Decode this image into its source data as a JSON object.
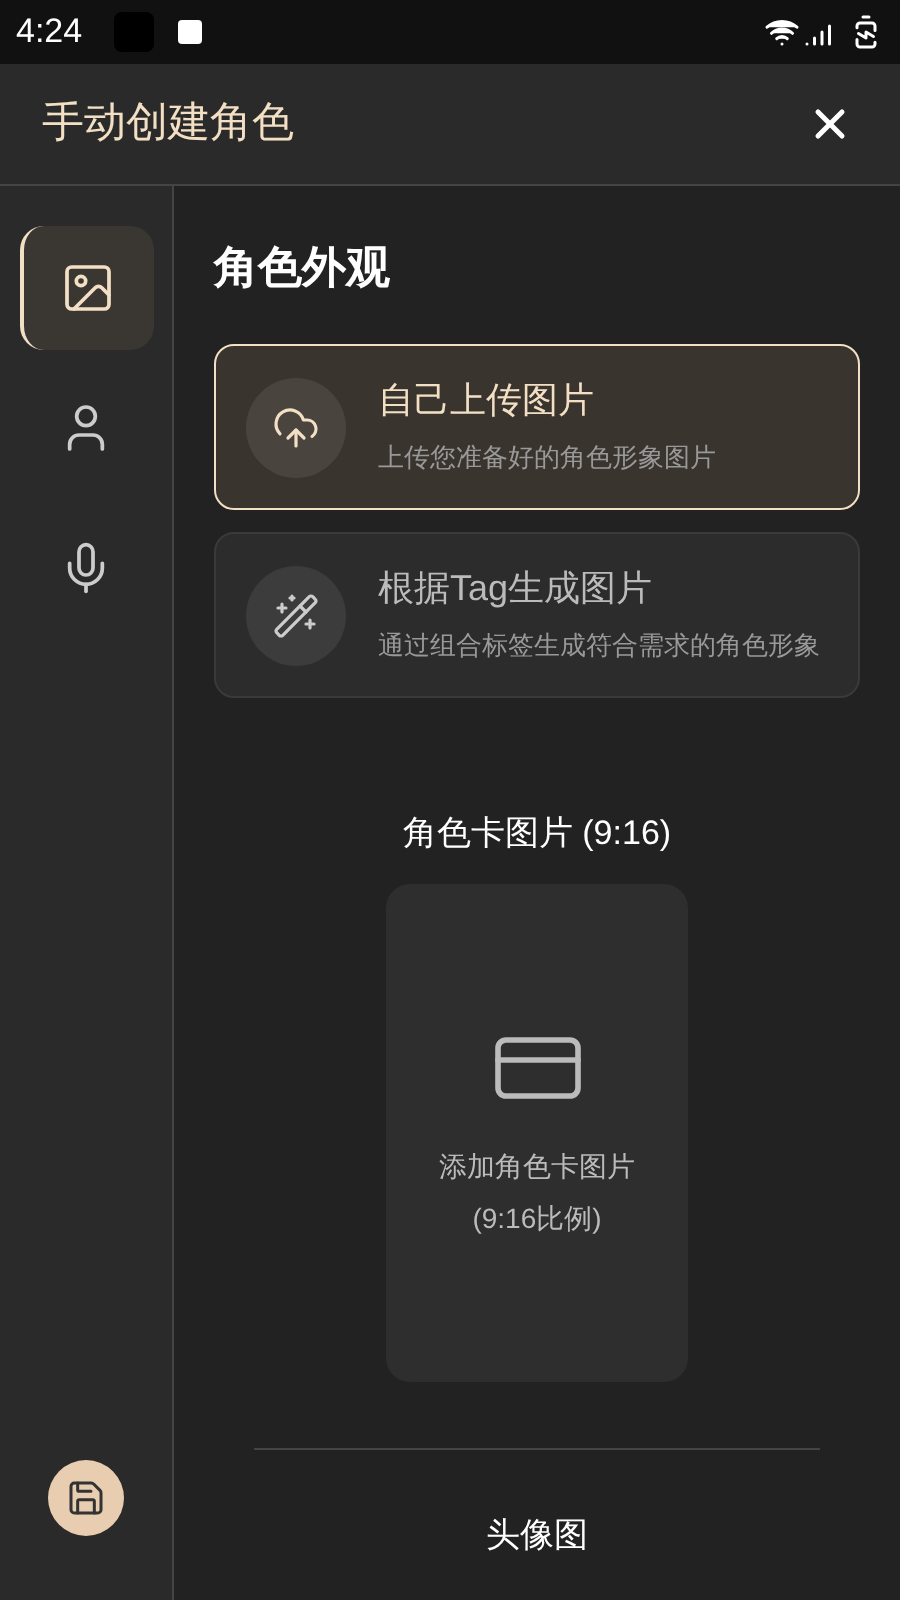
{
  "status_bar": {
    "time": "4:24"
  },
  "header": {
    "title": "手动创建角色"
  },
  "sidebar": {
    "items": [
      {
        "kind": "image",
        "selected": true
      },
      {
        "kind": "person",
        "selected": false
      },
      {
        "kind": "voice",
        "selected": false
      }
    ]
  },
  "section": {
    "title": "角色外观",
    "options": [
      {
        "kind": "upload",
        "title": "自己上传图片",
        "subtitle": "上传您准备好的角色形象图片",
        "selected": true
      },
      {
        "kind": "generate",
        "title": "根据Tag生成图片",
        "subtitle": "通过组合标签生成符合需求的角色形象",
        "selected": false
      }
    ],
    "card_image": {
      "title": "角色卡图片 (9:16)",
      "prompt": "添加角色卡图片",
      "ratio": "(9:16比例)"
    },
    "avatar_title": "头像图"
  }
}
